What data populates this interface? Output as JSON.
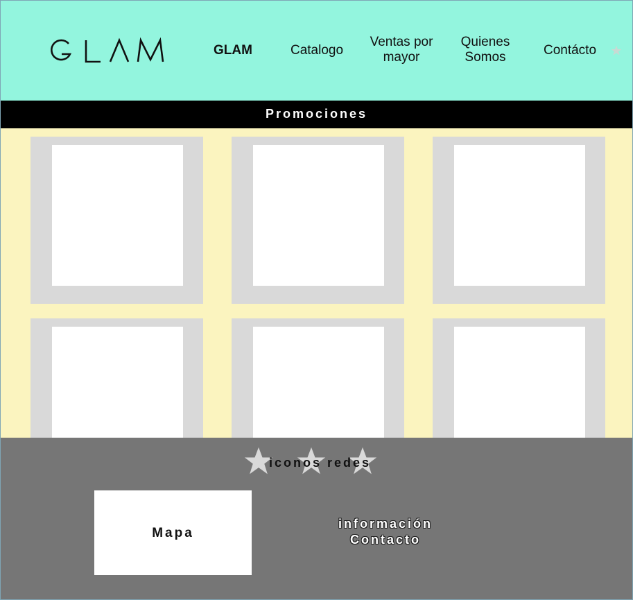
{
  "header": {
    "logo_text": "GLAM",
    "background": "#93f5de",
    "nav": {
      "brand": "GLAM",
      "catalogo": "Catalogo",
      "ventas_line1": "Ventas por",
      "ventas_line2": "mayor",
      "quienes_line1": "Quienes",
      "quienes_line2": "Somos",
      "contacto": "Contácto"
    },
    "extra_icon": "star-icon"
  },
  "promo": {
    "title": "Promociones",
    "background": "#000000",
    "grid_background": "#fbf4bf",
    "card_frame_color": "#d9d9d9",
    "cards": [
      "promo-card-1",
      "promo-card-2",
      "promo-card-3",
      "promo-card-4",
      "promo-card-5",
      "promo-card-6"
    ]
  },
  "footer": {
    "background": "#767676",
    "social_label": "iconos redes",
    "social_icons": [
      "star-icon",
      "star-icon",
      "star-icon"
    ],
    "map_label": "Mapa",
    "info_line1": "información",
    "info_line2": "Contacto"
  }
}
